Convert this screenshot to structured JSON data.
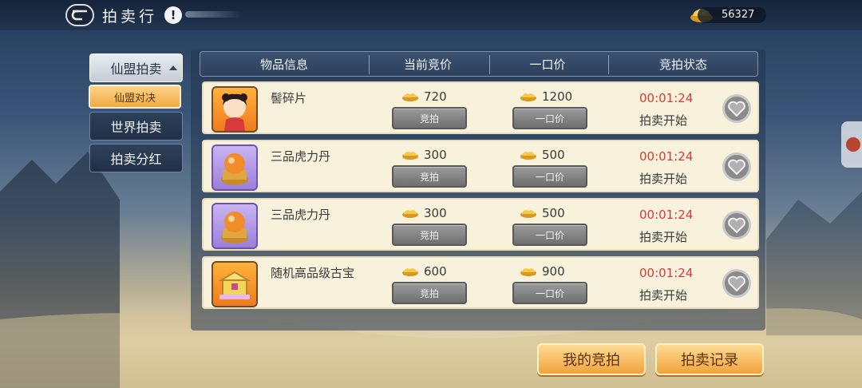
{
  "header": {
    "back_icon": "back-arrow-icon",
    "title": "拍卖行",
    "help_label": "!",
    "currency_amount": "56327"
  },
  "sidebar": {
    "tabs": [
      {
        "label": "仙盟拍卖",
        "active": true
      },
      {
        "label": "世界拍卖",
        "active": false
      },
      {
        "label": "拍卖分红",
        "active": false
      }
    ],
    "sub_tab": {
      "label": "仙盟对决"
    }
  },
  "table": {
    "columns": [
      "物品信息",
      "当前竞价",
      "一口价",
      "竞拍状态"
    ],
    "rows": [
      {
        "name": "髻碎片",
        "icon": "character-portrait-icon",
        "current_bid": "720",
        "buyout": "1200",
        "timer": "00:01:24",
        "status": "拍卖开始",
        "bid_label": "竞拍",
        "buyout_label": "一口价"
      },
      {
        "name": "三品虎力丹",
        "icon": "pill-orb-icon",
        "current_bid": "300",
        "buyout": "500",
        "timer": "00:01:24",
        "status": "拍卖开始",
        "bid_label": "竞拍",
        "buyout_label": "一口价"
      },
      {
        "name": "三品虎力丹",
        "icon": "pill-orb-icon",
        "current_bid": "300",
        "buyout": "500",
        "timer": "00:01:24",
        "status": "拍卖开始",
        "bid_label": "竞拍",
        "buyout_label": "一口价"
      },
      {
        "name": "随机高品级古宝",
        "icon": "treasure-chest-icon",
        "current_bid": "600",
        "buyout": "900",
        "timer": "00:01:24",
        "status": "拍卖开始",
        "bid_label": "竞拍",
        "buyout_label": "一口价"
      }
    ]
  },
  "footer": {
    "my_bids_label": "我的竞拍",
    "auction_log_label": "拍卖记录"
  },
  "colors": {
    "timer": "#d8393a",
    "button_orange": "#f2a33d",
    "row_bg": "#f8f1dc"
  }
}
